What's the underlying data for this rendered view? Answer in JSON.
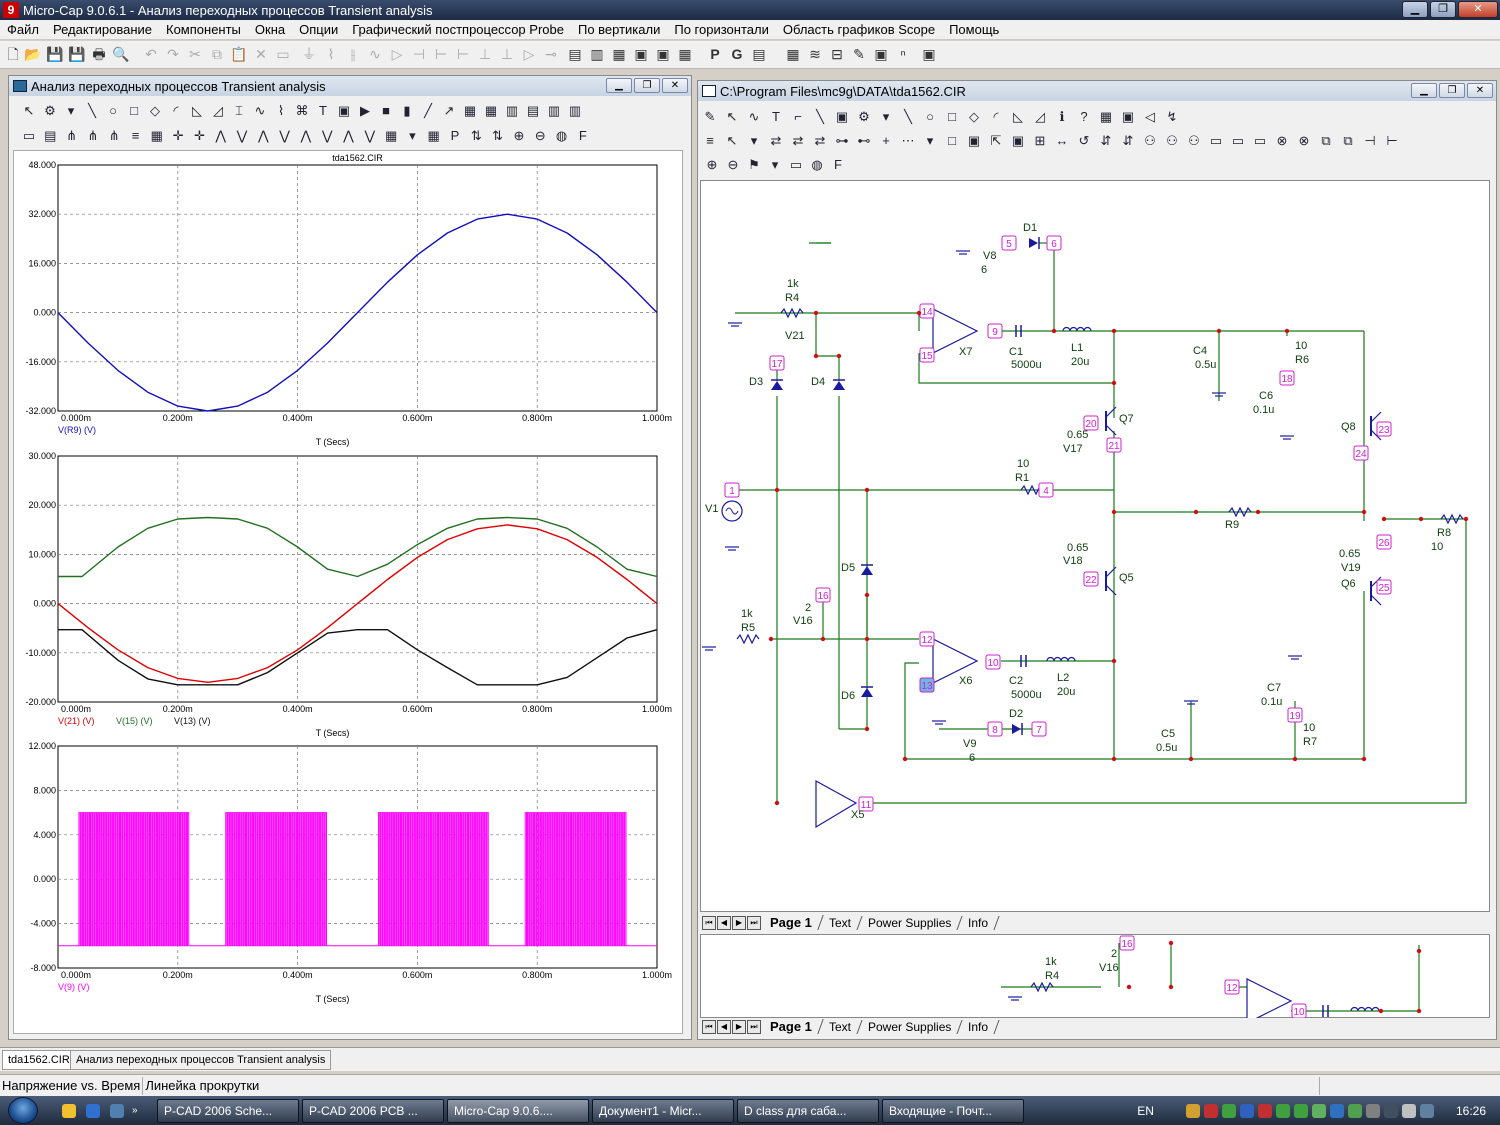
{
  "app": {
    "title": "Micro-Cap 9.0.6.1 - Анализ переходных процессов Transient analysis",
    "logo_letter": "9"
  },
  "menu": [
    "Файл",
    "Редактирование",
    "Компоненты",
    "Окна",
    "Опции",
    "Графический постпроцессор Probe",
    "По вертикали",
    "По горизонтали",
    "Область графиков Scope",
    "Помощь"
  ],
  "left_window": {
    "title": "Анализ переходных процессов Transient analysis",
    "plot_title": "tda1562.CIR"
  },
  "right_window": {
    "title": "C:\\Program Files\\mc9g\\DATA\\tda1562.CIR",
    "page_tabs": [
      "Page 1",
      "Text",
      "Power Supplies",
      "Info"
    ]
  },
  "chart_data": [
    {
      "type": "line",
      "title": "tda1562.CIR",
      "xlabel": "T (Secs)",
      "x_ticks": [
        "0.000m",
        "0.200m",
        "0.400m",
        "0.600m",
        "0.800m",
        "1.000m"
      ],
      "y_ticks": [
        "48.000",
        "32.000",
        "16.000",
        "0.000",
        "-16.000",
        "-32.000"
      ],
      "xlim": [
        0,
        1.0
      ],
      "ylim": [
        -32,
        48
      ],
      "grid": true,
      "series": [
        {
          "name": "V(R9) (V)",
          "color": "#1010c0",
          "x": [
            0,
            0.05,
            0.1,
            0.15,
            0.2,
            0.25,
            0.3,
            0.35,
            0.4,
            0.45,
            0.5,
            0.55,
            0.6,
            0.65,
            0.7,
            0.75,
            0.8,
            0.85,
            0.9,
            0.95,
            1.0
          ],
          "values": [
            0,
            -9.9,
            -18.8,
            -25.9,
            -30.4,
            -32,
            -30.4,
            -25.9,
            -18.8,
            -9.9,
            0,
            9.9,
            18.8,
            25.9,
            30.4,
            32,
            30.4,
            25.9,
            18.8,
            9.9,
            0
          ]
        }
      ]
    },
    {
      "type": "line",
      "xlabel": "T (Secs)",
      "x_ticks": [
        "0.000m",
        "0.200m",
        "0.400m",
        "0.600m",
        "0.800m",
        "1.000m"
      ],
      "y_ticks": [
        "30.000",
        "20.000",
        "10.000",
        "0.000",
        "-10.000",
        "-20.000"
      ],
      "xlim": [
        0,
        1.0
      ],
      "ylim": [
        -20,
        30
      ],
      "grid": true,
      "series": [
        {
          "name": "V(21) (V)",
          "color": "#e00000",
          "x": [
            0,
            0.05,
            0.1,
            0.15,
            0.2,
            0.25,
            0.3,
            0.35,
            0.4,
            0.45,
            0.5,
            0.55,
            0.6,
            0.65,
            0.7,
            0.75,
            0.8,
            0.85,
            0.9,
            0.95,
            1.0
          ],
          "values": [
            0,
            -4.9,
            -9.4,
            -13,
            -15.2,
            -16,
            -15.2,
            -13,
            -9.4,
            -4.9,
            0,
            4.9,
            9.4,
            13,
            15.2,
            16,
            15.2,
            13,
            9.4,
            4.9,
            0
          ]
        },
        {
          "name": "V(15) (V)",
          "color": "#207020",
          "x": [
            0,
            0.04,
            0.1,
            0.15,
            0.2,
            0.25,
            0.3,
            0.35,
            0.4,
            0.45,
            0.5,
            0.55,
            0.6,
            0.65,
            0.7,
            0.75,
            0.8,
            0.85,
            0.9,
            0.95,
            1.0
          ],
          "values": [
            5.5,
            5.5,
            11.5,
            15.3,
            17.2,
            17.5,
            17.2,
            15.3,
            11.5,
            7,
            5.5,
            8,
            12,
            15.3,
            17.2,
            17.5,
            17.2,
            15.3,
            11.5,
            7,
            5.5
          ]
        },
        {
          "name": "V(13) (V)",
          "color": "#101010",
          "x": [
            0,
            0.04,
            0.1,
            0.15,
            0.2,
            0.25,
            0.3,
            0.35,
            0.4,
            0.45,
            0.5,
            0.55,
            0.6,
            0.65,
            0.7,
            0.75,
            0.8,
            0.85,
            0.9,
            0.95,
            1.0
          ],
          "values": [
            -5.3,
            -5.3,
            -11.5,
            -15.3,
            -16.5,
            -16.5,
            -16.5,
            -14,
            -10,
            -6,
            -5.3,
            -5.3,
            -9.4,
            -13,
            -16.5,
            -16.5,
            -16.5,
            -15,
            -11,
            -7,
            -5.3
          ]
        }
      ]
    },
    {
      "type": "line",
      "xlabel": "T (Secs)",
      "x_ticks": [
        "0.000m",
        "0.200m",
        "0.400m",
        "0.600m",
        "0.800m",
        "1.000m"
      ],
      "y_ticks": [
        "12.000",
        "8.000",
        "4.000",
        "0.000",
        "-4.000",
        "-8.000"
      ],
      "xlim": [
        0,
        1.0
      ],
      "ylim": [
        -8,
        12
      ],
      "grid": true,
      "series": [
        {
          "name": "V(9) (V)",
          "color": "#ff00ff",
          "pwm_bursts": [
            [
              0.035,
              0.22
            ],
            [
              0.28,
              0.45
            ],
            [
              0.535,
              0.72
            ],
            [
              0.78,
              0.95
            ]
          ],
          "high": 6,
          "low": -6
        }
      ]
    }
  ],
  "schematic_labels": {
    "parts": [
      "D1",
      "V8",
      "6",
      "1k",
      "R4",
      "V21",
      "D3",
      "D4",
      "C1",
      "5000u",
      "L1",
      "20u",
      "X7",
      "C4",
      "0.5u",
      "10",
      "R6",
      "C6",
      "0.1u",
      "Q7",
      "0.65",
      "V17",
      "Q8",
      "V1",
      "R1",
      "R9",
      "R8",
      "0.65",
      "V18",
      "Q5",
      "V19",
      "Q6",
      "D5",
      "2",
      "V16",
      "R5",
      "X6",
      "C2",
      "L2",
      "D6",
      "D2",
      "V9",
      "C5",
      "C7",
      "R7",
      "X5"
    ],
    "nodes": [
      "5",
      "6",
      "14",
      "9",
      "15",
      "17",
      "18",
      "20",
      "21",
      "23",
      "24",
      "1",
      "4",
      "22",
      "26",
      "25",
      "16",
      "12",
      "10",
      "13",
      "8",
      "7",
      "19",
      "11"
    ]
  },
  "bottom_tabs": [
    "tda1562.CIR",
    "Анализ переходных процессов Transient analysis"
  ],
  "status": [
    "Напряжение vs. Время",
    "Линейка прокрутки"
  ],
  "taskbar": {
    "items": [
      "P-CAD 2006 Sche...",
      "P-CAD 2006 PCB ...",
      "Micro-Cap 9.0.6....",
      "Документ1 - Micr...",
      "D class для саба...",
      "Входящие - Почт..."
    ],
    "lang": "EN",
    "clock": "16:26"
  }
}
